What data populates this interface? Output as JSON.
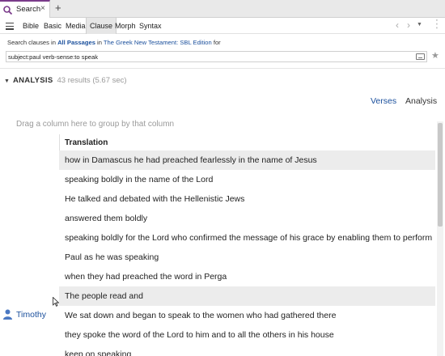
{
  "tab": {
    "label": "Search",
    "icon": "search-logo-icon",
    "close": "×",
    "new_tab": "+"
  },
  "toolbar": {
    "tabs": [
      "Bible",
      "Basic",
      "Media",
      "Clause",
      "Morph",
      "Syntax"
    ],
    "active_tab": "Clause",
    "back": "‹",
    "forward": "›",
    "dropdown": "▼"
  },
  "search": {
    "prefix": "Search clauses in ",
    "passages": "All Passages",
    "in_text": " in ",
    "resource": "The Greek New Testament: SBL Edition",
    "suffix": " for",
    "query": "subject:paul verb-sense:to speak"
  },
  "analysis": {
    "title": "ANALYSIS",
    "results": "43 results (5.67 sec)",
    "view_verses": "Verses",
    "view_analysis": "Analysis",
    "group_hint": "Drag a column here to group by that column",
    "column": "Translation",
    "rows": [
      "how in Damascus he had preached fearlessly in the name of Jesus",
      "speaking boldly in the name of the Lord",
      "He talked and debated with the Hellenistic Jews",
      "answered them boldly",
      "speaking boldly for the Lord who confirmed the message of his grace by enabling them to perform",
      "Paul as he was speaking",
      "when they had preached the word in Perga",
      "The people read and",
      "We sat down and began to speak to the women who had gathered there",
      "they spoke the word of the Lord to him and to all the others in his house",
      "keep on speaking"
    ],
    "user": "Timothy"
  },
  "colors": {
    "accent": "#1a4f9c",
    "tab_top": "#7a3b8a"
  }
}
